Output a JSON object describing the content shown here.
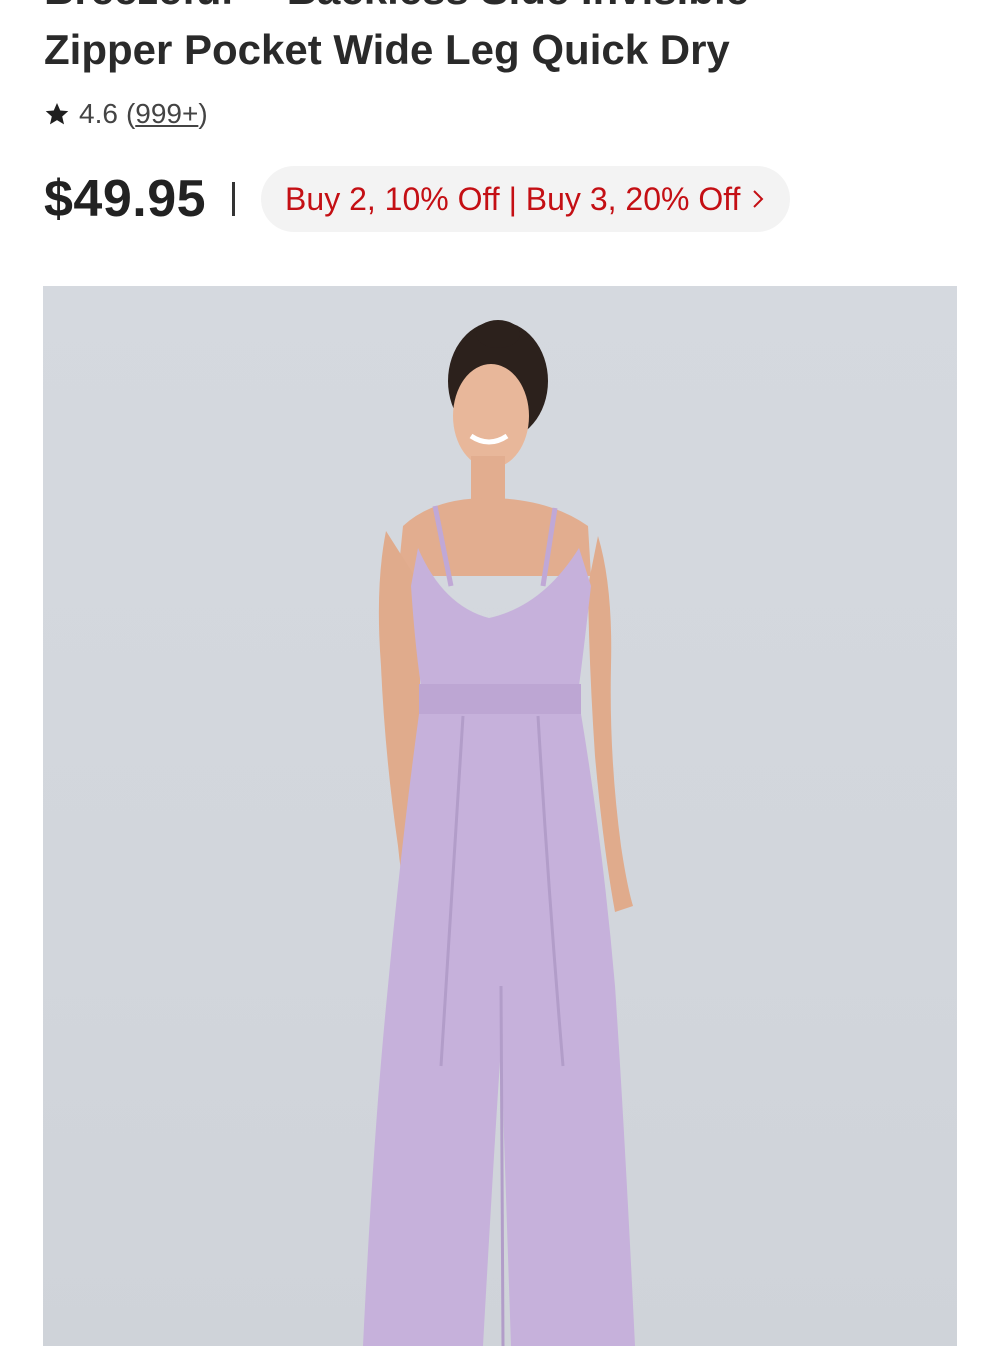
{
  "product": {
    "title_line1": "Breezeful™ Backless Side Invisible",
    "title_line2": "Zipper Pocket Wide Leg Quick Dry",
    "rating": "4.6",
    "review_count": "999+",
    "price": "$49.95",
    "promo": "Buy 2, 10% Off | Buy 3, 20% Off",
    "image_alt": "Model wearing lavender wide leg jumpsuit"
  },
  "colors": {
    "promo_text": "#c40f14",
    "jumpsuit": "#c6b1db",
    "background": "#d4d8de"
  }
}
